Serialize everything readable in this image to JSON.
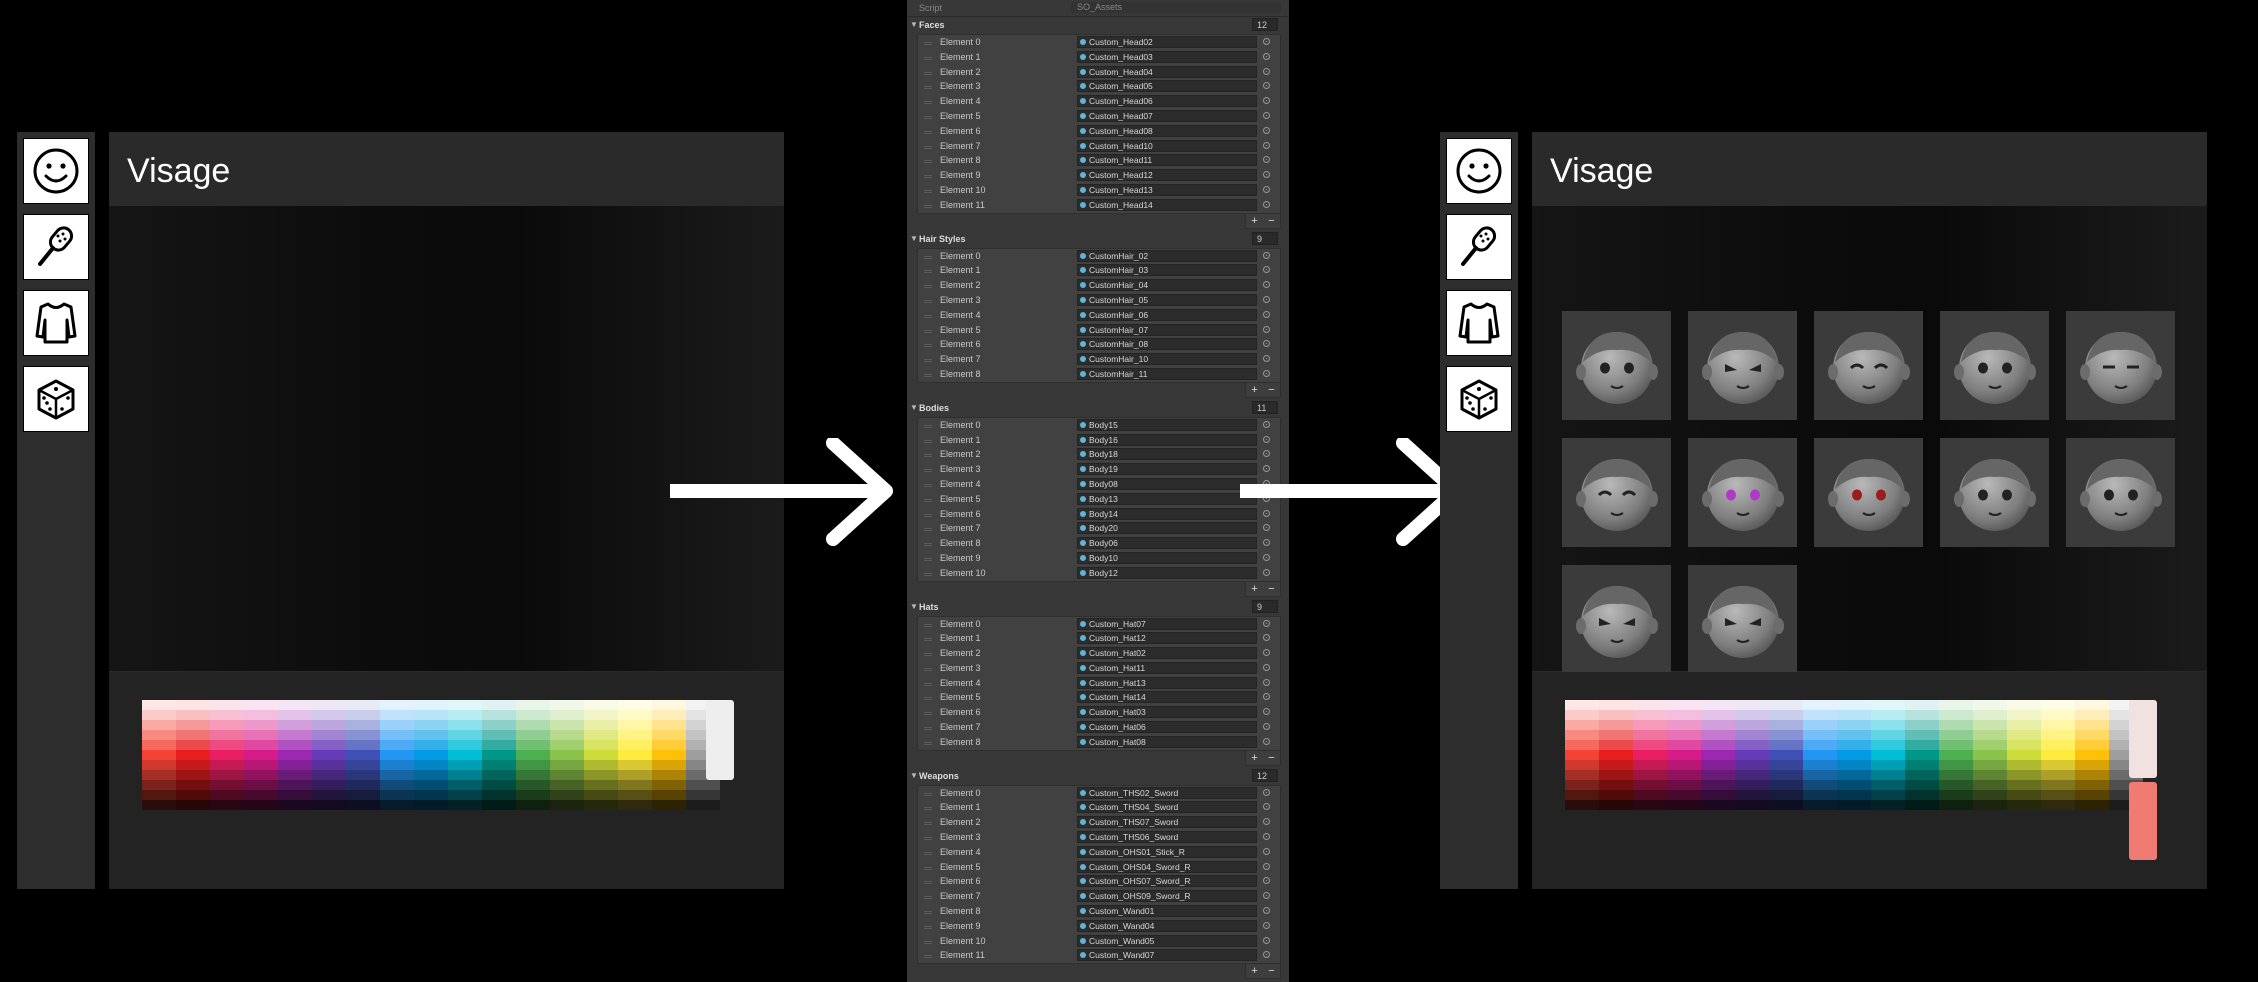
{
  "left_panel": {
    "title": "Visage",
    "category_icons": [
      "smile-icon",
      "hairbrush-icon",
      "shirt-icon",
      "dice-icon"
    ],
    "preview_color": "#eeeeee"
  },
  "right_panel": {
    "title": "Visage",
    "category_icons": [
      "smile-icon",
      "hairbrush-icon",
      "shirt-icon",
      "dice-icon"
    ],
    "face_count": 12,
    "preview_colors": [
      "#f2e1e1",
      "#ef7b72"
    ]
  },
  "inspector": {
    "script_label": "Script",
    "script_value": "SO_Assets",
    "sections": [
      {
        "name": "Faces",
        "count": "12",
        "items": [
          {
            "label": "Element 0",
            "value": "Custom_Head02"
          },
          {
            "label": "Element 1",
            "value": "Custom_Head03"
          },
          {
            "label": "Element 2",
            "value": "Custom_Head04"
          },
          {
            "label": "Element 3",
            "value": "Custom_Head05"
          },
          {
            "label": "Element 4",
            "value": "Custom_Head06"
          },
          {
            "label": "Element 5",
            "value": "Custom_Head07"
          },
          {
            "label": "Element 6",
            "value": "Custom_Head08"
          },
          {
            "label": "Element 7",
            "value": "Custom_Head10"
          },
          {
            "label": "Element 8",
            "value": "Custom_Head11"
          },
          {
            "label": "Element 9",
            "value": "Custom_Head12"
          },
          {
            "label": "Element 10",
            "value": "Custom_Head13"
          },
          {
            "label": "Element 11",
            "value": "Custom_Head14"
          }
        ]
      },
      {
        "name": "Hair Styles",
        "count": "9",
        "items": [
          {
            "label": "Element 0",
            "value": "CustomHair_02"
          },
          {
            "label": "Element 1",
            "value": "CustomHair_03"
          },
          {
            "label": "Element 2",
            "value": "CustomHair_04"
          },
          {
            "label": "Element 3",
            "value": "CustomHair_05"
          },
          {
            "label": "Element 4",
            "value": "CustomHair_06"
          },
          {
            "label": "Element 5",
            "value": "CustomHair_07"
          },
          {
            "label": "Element 6",
            "value": "CustomHair_08"
          },
          {
            "label": "Element 7",
            "value": "CustomHair_10"
          },
          {
            "label": "Element 8",
            "value": "CustomHair_11"
          }
        ]
      },
      {
        "name": "Bodies",
        "count": "11",
        "items": [
          {
            "label": "Element 0",
            "value": "Body15"
          },
          {
            "label": "Element 1",
            "value": "Body16"
          },
          {
            "label": "Element 2",
            "value": "Body18"
          },
          {
            "label": "Element 3",
            "value": "Body19"
          },
          {
            "label": "Element 4",
            "value": "Body08"
          },
          {
            "label": "Element 5",
            "value": "Body13"
          },
          {
            "label": "Element 6",
            "value": "Body14"
          },
          {
            "label": "Element 7",
            "value": "Body20"
          },
          {
            "label": "Element 8",
            "value": "Body06"
          },
          {
            "label": "Element 9",
            "value": "Body10"
          },
          {
            "label": "Element 10",
            "value": "Body12"
          }
        ]
      },
      {
        "name": "Hats",
        "count": "9",
        "items": [
          {
            "label": "Element 0",
            "value": "Custom_Hat07"
          },
          {
            "label": "Element 1",
            "value": "Custom_Hat12"
          },
          {
            "label": "Element 2",
            "value": "Custom_Hat02"
          },
          {
            "label": "Element 3",
            "value": "Custom_Hat11"
          },
          {
            "label": "Element 4",
            "value": "Custom_Hat13"
          },
          {
            "label": "Element 5",
            "value": "Custom_Hat14"
          },
          {
            "label": "Element 6",
            "value": "Custom_Hat03"
          },
          {
            "label": "Element 7",
            "value": "Custom_Hat06"
          },
          {
            "label": "Element 8",
            "value": "Custom_Hat08"
          }
        ]
      },
      {
        "name": "Weapons",
        "count": "12",
        "items": [
          {
            "label": "Element 0",
            "value": "Custom_THS02_Sword"
          },
          {
            "label": "Element 1",
            "value": "Custom_THS04_Sword"
          },
          {
            "label": "Element 2",
            "value": "Custom_THS07_Sword"
          },
          {
            "label": "Element 3",
            "value": "Custom_THS06_Sword"
          },
          {
            "label": "Element 4",
            "value": "Custom_OHS01_Stick_R"
          },
          {
            "label": "Element 5",
            "value": "Custom_OHS04_Sword_R"
          },
          {
            "label": "Element 6",
            "value": "Custom_OHS07_Sword_R"
          },
          {
            "label": "Element 7",
            "value": "Custom_OHS09_Sword_R"
          },
          {
            "label": "Element 8",
            "value": "Custom_Wand01"
          },
          {
            "label": "Element 9",
            "value": "Custom_Wand04"
          },
          {
            "label": "Element 10",
            "value": "Custom_Wand05"
          },
          {
            "label": "Element 11",
            "value": "Custom_Wand07"
          }
        ]
      }
    ],
    "add_button": "+",
    "remove_button": "−"
  },
  "palette": {
    "hues": [
      "#f44336",
      "#e91e1e",
      "#e91e63",
      "#d81b8a",
      "#9c27b0",
      "#673ab7",
      "#3f51b5",
      "#2196f3",
      "#039be5",
      "#00bcd4",
      "#009688",
      "#4caf50",
      "#8bc34a",
      "#cddc39",
      "#ffeb3b",
      "#ffc107",
      "#9e9e9e"
    ]
  }
}
